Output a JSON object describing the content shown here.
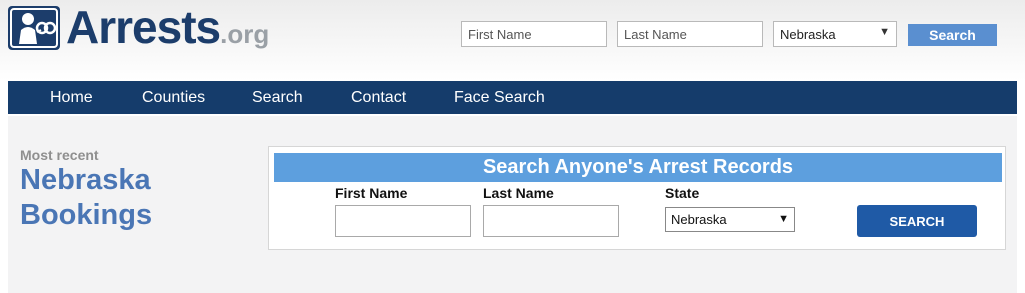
{
  "brand": {
    "name": "Arrests",
    "tld": ".org",
    "icon": "handcuffed-figure-icon",
    "color": "#1c3d6b"
  },
  "header_search": {
    "first_name_placeholder": "First Name",
    "last_name_placeholder": "Last Name",
    "state_selected": "Nebraska",
    "button_label": "Search",
    "button_color": "#5a8fd0"
  },
  "nav": {
    "background": "#153c6b",
    "items": [
      {
        "label": "Home"
      },
      {
        "label": "Counties"
      },
      {
        "label": "Search"
      },
      {
        "label": "Contact"
      },
      {
        "label": "Face Search"
      }
    ]
  },
  "sidebar": {
    "kicker": "Most recent",
    "title": "Nebraska Bookings"
  },
  "search_panel": {
    "title": "Search Anyone's Arrest Records",
    "first_name_label": "First Name",
    "first_name_value": "",
    "last_name_label": "Last Name",
    "last_name_value": "",
    "state_label": "State",
    "state_selected": "Nebraska",
    "button_label": "SEARCH",
    "title_color": "#5d9fde",
    "button_color": "#1f5aa6"
  }
}
